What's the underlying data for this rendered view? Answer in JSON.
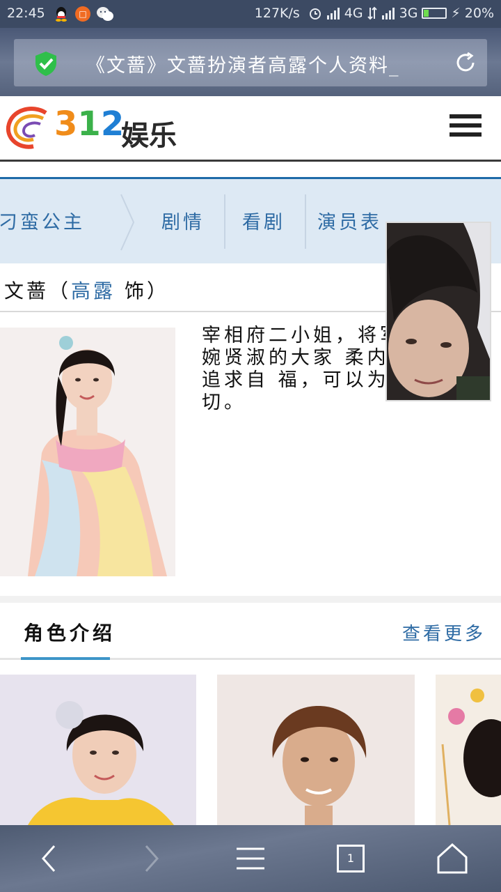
{
  "status_bar": {
    "time": "22:45",
    "speed": "127K/s",
    "network1": "4G",
    "network2": "3G",
    "battery": "20%",
    "battery_level": 0.2
  },
  "address_bar": {
    "title": "《文蔷》文蔷扮演者高露个人资料_"
  },
  "site": {
    "logo_number": "312",
    "logo_text": "娱乐"
  },
  "nav": {
    "items": [
      "刁蛮公主",
      "剧情",
      "看剧",
      "演员表"
    ]
  },
  "character": {
    "name": "文蔷",
    "open_paren": "（",
    "actor": "高露",
    "role_suffix": " 饰）",
    "bio": "宰相府二小姐，将军 人，温婉贤淑的大家 柔内刚，敢于追求自 福，可以为爱付出一切。"
  },
  "section": {
    "title": "角色介绍",
    "more_link": "查看更多"
  },
  "bottom_bar": {
    "tab_count": "1"
  },
  "colors": {
    "accent_blue": "#2e6ba4",
    "nav_bg": "#dde9f4",
    "underline": "#3d95c8"
  }
}
